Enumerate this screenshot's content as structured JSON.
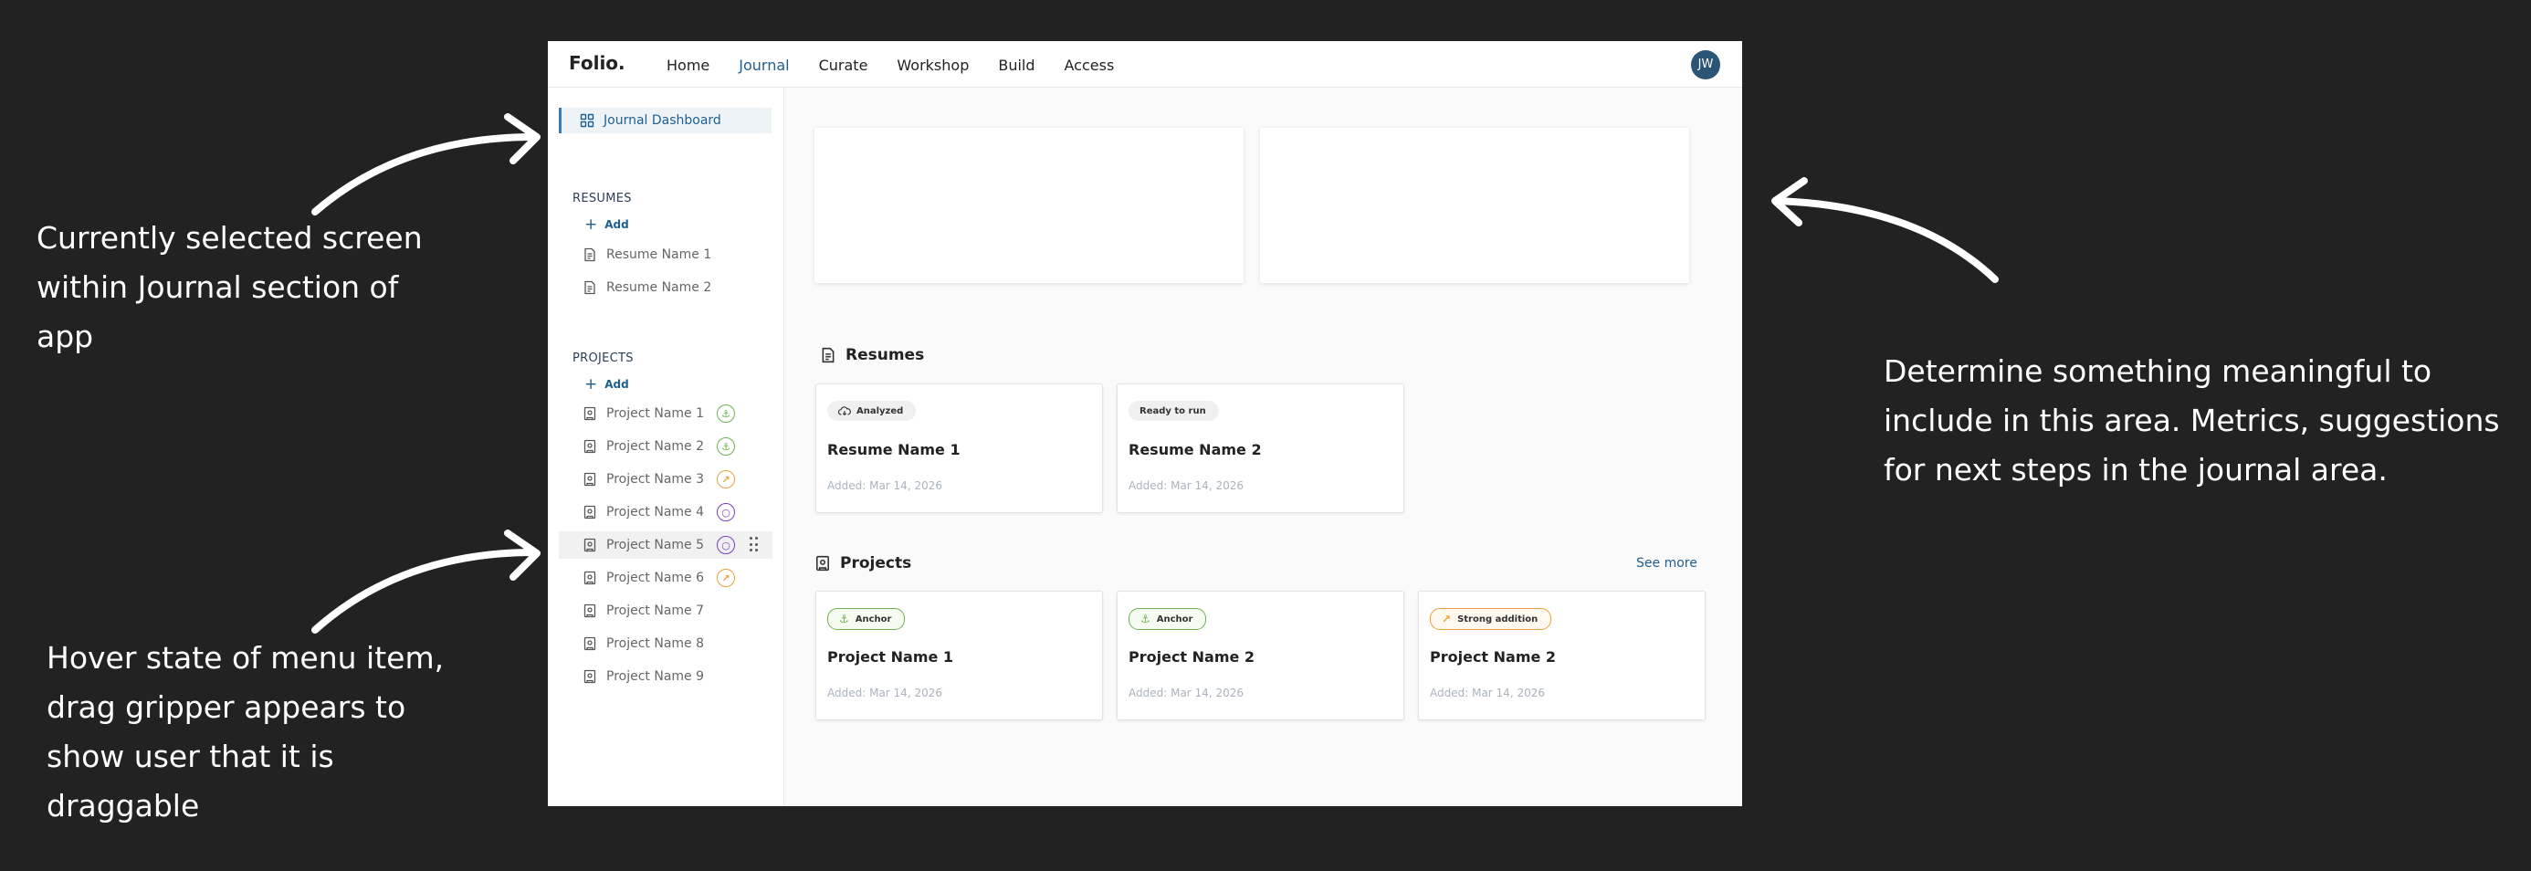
{
  "annotations": {
    "left_top": [
      "Currently selected screen",
      "within Journal section of",
      "app"
    ],
    "left_bottom": [
      "Hover state of menu item,",
      "drag gripper appears to",
      "show user that it is",
      "draggable"
    ],
    "right": [
      "Determine something meaningful to",
      "include in this area.  Metrics, suggestions",
      "for next steps in the journal area."
    ]
  },
  "app": {
    "logo": "Folio.",
    "nav": [
      "Home",
      "Journal",
      "Curate",
      "Workshop",
      "Build",
      "Access"
    ],
    "active_nav": "Journal",
    "avatar_initials": "JW",
    "accent_color": "#1f5f8f"
  },
  "sidebar": {
    "dashboard_label": "Journal Dashboard",
    "resumes_header": "RESUMES",
    "resumes_add": "Add",
    "resumes": [
      "Resume Name 1",
      "Resume Name 2"
    ],
    "projects_header": "PROJECTS",
    "projects_add": "Add",
    "projects": [
      {
        "label": "Project Name 1",
        "badge": "anchor-icon",
        "badge_color": "green"
      },
      {
        "label": "Project Name 2",
        "badge": "anchor-icon",
        "badge_color": "green"
      },
      {
        "label": "Project Name 3",
        "badge": "trend-up-icon",
        "badge_color": "orange"
      },
      {
        "label": "Project Name 4",
        "badge": "chat-icon",
        "badge_color": "purple"
      },
      {
        "label": "Project Name 5",
        "badge": "chat-icon",
        "badge_color": "purple",
        "hover": true
      },
      {
        "label": "Project Name 6",
        "badge": "trend-up-icon",
        "badge_color": "orange"
      },
      {
        "label": "Project Name 7"
      },
      {
        "label": "Project Name 8"
      },
      {
        "label": "Project Name 9"
      }
    ]
  },
  "main": {
    "resumes_title": "Resumes",
    "resume_cards": [
      {
        "status": "Analyzed",
        "status_icon": "cloud-icon",
        "title": "Resume Name 1",
        "date": "Added: Mar 14, 2026"
      },
      {
        "status": "Ready to run",
        "title": "Resume Name 2",
        "date": "Added: Mar 14, 2026"
      }
    ],
    "projects_title": "Projects",
    "see_more": "See more",
    "project_cards": [
      {
        "status": "Anchor",
        "status_icon": "anchor-icon",
        "style": "green",
        "title": "Project Name 1",
        "date": "Added: Mar 14, 2026"
      },
      {
        "status": "Anchor",
        "status_icon": "anchor-icon",
        "style": "green",
        "title": "Project Name 2",
        "date": "Added: Mar 14, 2026"
      },
      {
        "status": "Strong addition",
        "status_icon": "trend-up-icon",
        "style": "orange",
        "title": "Project Name 2",
        "date": "Added: Mar 14, 2026"
      }
    ]
  }
}
